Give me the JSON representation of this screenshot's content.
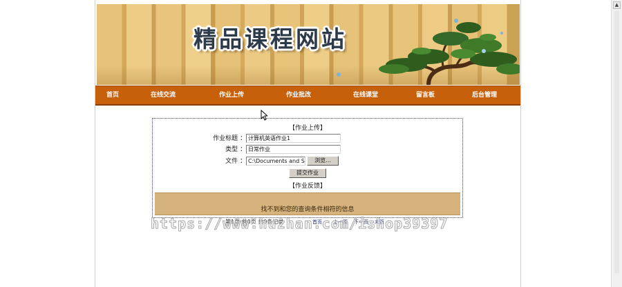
{
  "header": {
    "site_title": "精品课程网站"
  },
  "nav": {
    "items": [
      {
        "label": "首页"
      },
      {
        "label": "在线交流"
      },
      {
        "label": "作业上传"
      },
      {
        "label": "作业批改"
      },
      {
        "label": "在线课堂"
      },
      {
        "label": "留言板"
      },
      {
        "label": "后台管理"
      }
    ]
  },
  "upload": {
    "section_title": "【作业上传】",
    "title_label": "作业标题 ：",
    "title_value": "计算机英语作业1",
    "type_label": "类型 ：",
    "type_value": "日常作业",
    "file_label": "文件 ：",
    "file_value": "C:\\Documents and Se",
    "browse_label": "浏览...",
    "submit_label": "提交作业"
  },
  "feedback": {
    "section_title": "【作业反馈】",
    "empty_message": "找不到和您的查询条件相符的信息"
  },
  "pager": {
    "status": "第1页   共0页   共0条记录",
    "first": "首页",
    "prev": "上一页",
    "next": "下一页",
    "last": "末页"
  },
  "watermark": "https://www.huzhan.com/ishop39397",
  "colors": {
    "nav_bg": "#c7600a",
    "feedback_bg": "#d6b27c",
    "panel_border": "#3a3aa8"
  }
}
